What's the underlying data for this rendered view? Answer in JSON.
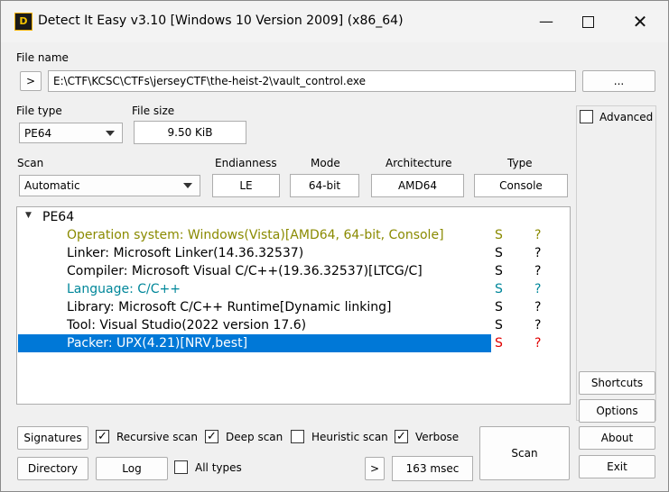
{
  "window": {
    "title": "Detect It Easy v3.10 [Windows 10 Version 2009] (x86_64)",
    "icon_text": "D",
    "minimize": "—",
    "close": "✕"
  },
  "file": {
    "label": "File name",
    "history_button": ">",
    "path": "E:\\CTF\\KCSC\\CTFs\\jerseyCTF\\the-heist-2\\vault_control.exe",
    "browse_button": "..."
  },
  "file_type": {
    "label": "File type",
    "value": "PE64"
  },
  "file_size": {
    "label": "File size",
    "value": "9.50 KiB"
  },
  "scan_mode": {
    "label": "Scan",
    "value": "Automatic"
  },
  "info": {
    "endianness": {
      "label": "Endianness",
      "value": "LE"
    },
    "mode": {
      "label": "Mode",
      "value": "64-bit"
    },
    "architecture": {
      "label": "Architecture",
      "value": "AMD64"
    },
    "type": {
      "label": "Type",
      "value": "Console"
    }
  },
  "results": {
    "root": "PE64",
    "expand_glyph": "▼",
    "rows": [
      {
        "text": "Operation system: Windows(Vista)[AMD64, 64-bit, Console]",
        "s": "S",
        "q": "?"
      },
      {
        "text": "Linker: Microsoft Linker(14.36.32537)",
        "s": "S",
        "q": "?"
      },
      {
        "text": "Compiler: Microsoft Visual C/C++(19.36.32537)[LTCG/C]",
        "s": "S",
        "q": "?"
      },
      {
        "text": "Language: C/C++",
        "s": "S",
        "q": "?"
      },
      {
        "text": "Library: Microsoft C/C++ Runtime[Dynamic linking]",
        "s": "S",
        "q": "?"
      },
      {
        "text": "Tool: Visual Studio(2022 version 17.6)",
        "s": "S",
        "q": "?"
      },
      {
        "text": "Packer: UPX(4.21)[NRV,best]",
        "s": "S",
        "q": "?"
      }
    ]
  },
  "right": {
    "advanced": "Advanced",
    "shortcuts": "Shortcuts",
    "options": "Options",
    "about": "About",
    "exit": "Exit"
  },
  "bottom": {
    "signatures": "Signatures",
    "recursive": "Recursive scan",
    "deep": "Deep scan",
    "heuristic": "Heuristic scan",
    "verbose": "Verbose",
    "directory": "Directory",
    "log": "Log",
    "all_types": "All types",
    "more": ">",
    "time": "163 msec",
    "scan": "Scan"
  },
  "checks": {
    "advanced": false,
    "recursive": true,
    "deep": true,
    "heuristic": false,
    "verbose": true,
    "all_types": false
  },
  "colors": {
    "selection": "#0078d7",
    "os_text": "#8a8a00",
    "language_text": "#00879a",
    "packer_status": "#e00000"
  }
}
